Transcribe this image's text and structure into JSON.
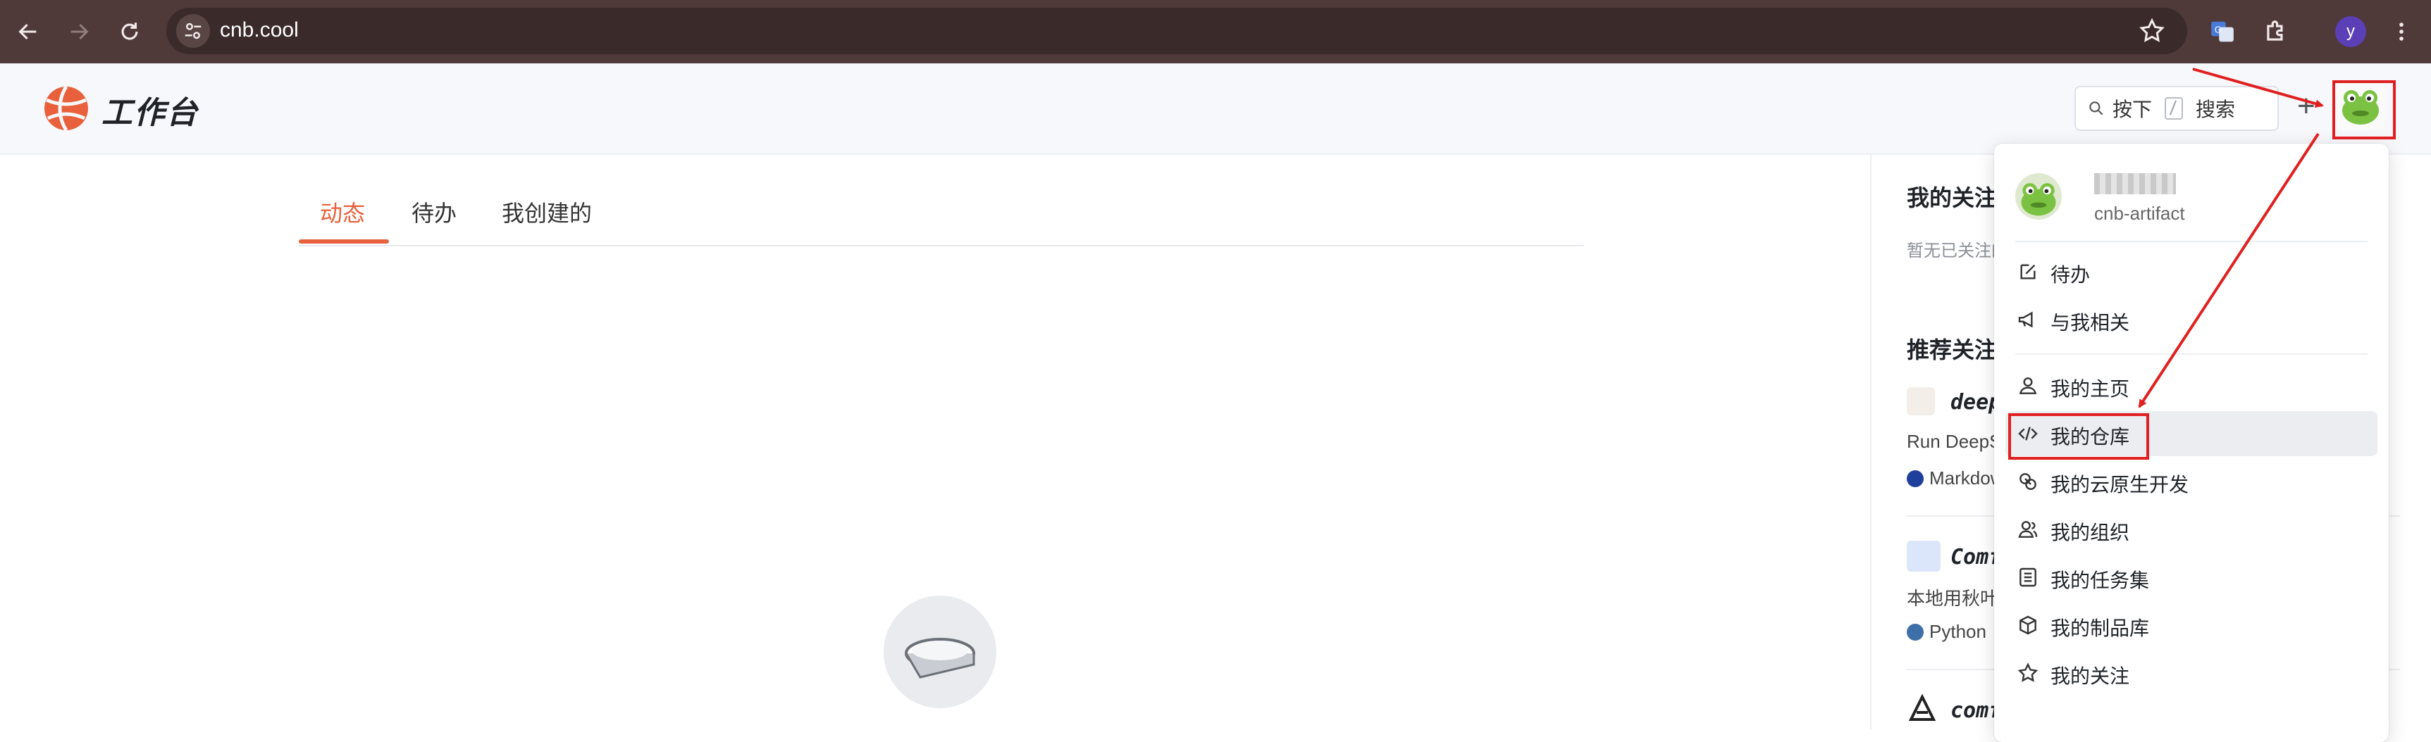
{
  "browser": {
    "url": "cnb.cool",
    "profile_initial": "y",
    "icons": [
      "back-icon",
      "forward-icon",
      "reload-icon",
      "site-settings-icon",
      "bookmark-star-icon",
      "google-translate-icon",
      "extensions-icon",
      "profile-icon",
      "more-icon"
    ]
  },
  "header": {
    "logo_text": "工作台",
    "search_label_prefix": "按下",
    "search_label_suffix": "搜索",
    "plus": "+"
  },
  "main": {
    "tabs": [
      {
        "label": "动态",
        "active": true
      },
      {
        "label": "待办",
        "active": false
      },
      {
        "label": "我创建的",
        "active": false
      }
    ]
  },
  "right_column": {
    "following_title": "我的关注",
    "following_empty": "暂无已关注的",
    "recommend_title": "推荐关注",
    "repos": [
      {
        "name": "deep",
        "desc": "Run DeepS",
        "lang": "Markdow",
        "lang_color": "#1f3f9c"
      },
      {
        "name": "Comf",
        "desc": "本地用秋叶",
        "lang": "Python",
        "lang_color": "#3f6fa8"
      },
      {
        "name": "comf",
        "desc": "",
        "lang": "",
        "lang_color": ""
      }
    ]
  },
  "menu": {
    "user_sub": "cnb-artifact",
    "sections": [
      [
        {
          "label": "待办",
          "icon": "edit-icon"
        },
        {
          "label": "与我相关",
          "icon": "megaphone-icon"
        }
      ],
      [
        {
          "label": "我的主页",
          "icon": "user-icon"
        },
        {
          "label": "我的仓库",
          "icon": "code-icon",
          "highlighted": true
        },
        {
          "label": "我的云原生开发",
          "icon": "cloud-dev-icon"
        },
        {
          "label": "我的组织",
          "icon": "org-icon"
        },
        {
          "label": "我的任务集",
          "icon": "task-list-icon"
        },
        {
          "label": "我的制品库",
          "icon": "package-icon"
        },
        {
          "label": "我的关注",
          "icon": "star-icon"
        }
      ]
    ]
  },
  "colors": {
    "accent": "#e8603c",
    "annotation": "#e02020",
    "chrome": "#4f3939"
  }
}
